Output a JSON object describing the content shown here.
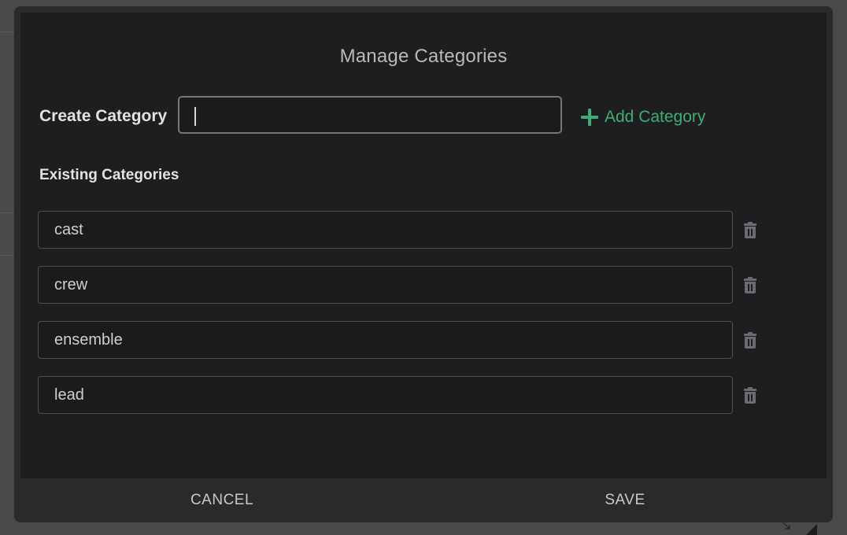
{
  "modal": {
    "title": "Manage Categories"
  },
  "create": {
    "label": "Create Category",
    "value": "",
    "placeholder": "",
    "add_label": "Add Category"
  },
  "existing": {
    "label": "Existing Categories",
    "items": [
      {
        "name": "cast"
      },
      {
        "name": "crew"
      },
      {
        "name": "ensemble"
      },
      {
        "name": "lead"
      }
    ]
  },
  "footer": {
    "cancel_label": "CANCEL",
    "save_label": "SAVE"
  },
  "colors": {
    "accent": "#3fae74",
    "modal_background": "#1e1e20",
    "footer_background": "#2a2a2d"
  },
  "icons": {
    "add": "plus-icon",
    "delete": "trash-icon"
  }
}
